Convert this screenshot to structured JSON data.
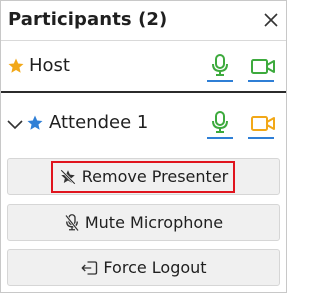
{
  "header": {
    "title": "Participants (2)",
    "close_icon": "close-icon"
  },
  "participants": [
    {
      "name": "Host",
      "role_icon": "star-icon",
      "role_color": "#f2a818",
      "mic_color": "#3daa3d",
      "mic_underline": "#2f7fd6",
      "cam_color": "#3daa3d",
      "cam_underline": "#2f7fd6"
    },
    {
      "name": "Attendee 1",
      "role_icon": "star-icon",
      "role_color": "#2f7fd6",
      "expand_icon": "chevron-down-icon",
      "mic_color": "#3daa3d",
      "mic_underline": "#2f7fd6",
      "cam_color": "#f2a818",
      "cam_underline": "#2f7fd6"
    }
  ],
  "actions": {
    "remove_presenter": {
      "label": "Remove Presenter",
      "icon": "star-off-icon"
    },
    "mute_microphone": {
      "label": "Mute Microphone",
      "icon": "mic-off-icon"
    },
    "force_logout": {
      "label": "Force Logout",
      "icon": "logout-icon"
    }
  },
  "colors": {
    "highlight": "#e0141e",
    "button_bg": "#f0f0f0"
  }
}
